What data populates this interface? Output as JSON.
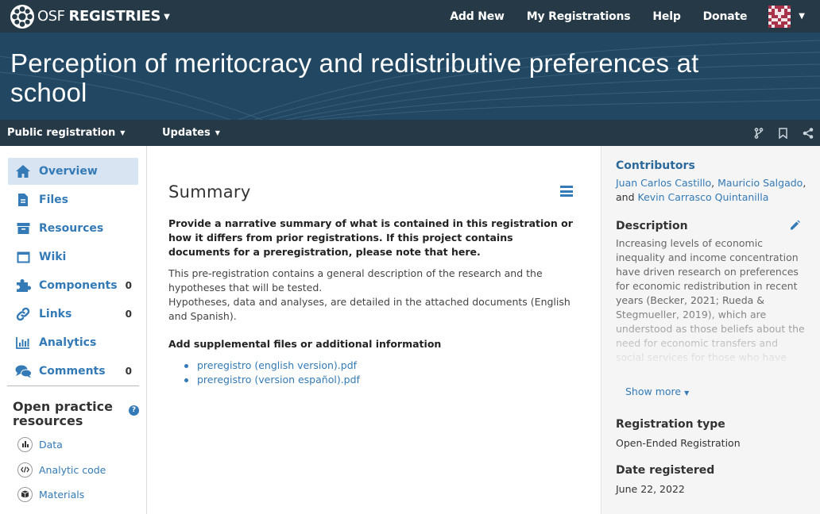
{
  "navbar": {
    "brand_osf": "OSF",
    "brand_registries": "REGISTRIES",
    "links": [
      "Add New",
      "My Registrations",
      "Help",
      "Donate"
    ]
  },
  "hero": {
    "title": "Perception of meritocracy and redistributive preferences at school"
  },
  "subbar": {
    "public_registration": "Public registration",
    "updates": "Updates"
  },
  "sidebar": {
    "items": [
      {
        "label": "Overview",
        "count": ""
      },
      {
        "label": "Files",
        "count": ""
      },
      {
        "label": "Resources",
        "count": ""
      },
      {
        "label": "Wiki",
        "count": ""
      },
      {
        "label": "Components",
        "count": "0"
      },
      {
        "label": "Links",
        "count": "0"
      },
      {
        "label": "Analytics",
        "count": ""
      },
      {
        "label": "Comments",
        "count": "0"
      }
    ],
    "open_practice": {
      "title": "Open practice resources",
      "help": "?",
      "items": [
        "Data",
        "Analytic code",
        "Materials"
      ]
    }
  },
  "main": {
    "title": "Summary",
    "question1": "Provide a narrative summary of what is contained in this registration or how it differs from prior registrations. If this project contains documents for a preregistration, please note that here.",
    "answer1_p1": "This pre-registration contains a general description of the research and the hypotheses that will be tested.",
    "answer1_p2": "Hypotheses, data and analyses, are detailed in the attached documents (English and Spanish).",
    "question2": "Add supplemental files or additional information",
    "files": [
      "preregistro (english version).pdf",
      "preregistro (version español).pdf"
    ]
  },
  "right": {
    "contributors_label": "Contributors",
    "contributor_1": "Juan Carlos Castillo",
    "contributor_2": "Mauricio Salgado",
    "contributor_3": "Kevin Carrasco Quintanilla",
    "sep_comma": ",",
    "sep_and": ", and ",
    "description_label": "Description",
    "description": "Increasing levels of economic inequality and income concentration have driven research on preferences for economic redistribution in recent years (Becker, 2021; Rueda & Stegmueller, 2019), which are understood as those beliefs about the need for economic transfers and social services for those who have less, generally through the State. However, most of the research on",
    "show_more": "Show more",
    "registration_type_label": "Registration type",
    "registration_type": "Open-Ended Registration",
    "date_registered_label": "Date registered",
    "date_registered": "June 22, 2022"
  },
  "colors": {
    "navbar": "#263947",
    "hero": "#214762",
    "link": "#337ab7",
    "active_bg": "#d8e4f2"
  }
}
